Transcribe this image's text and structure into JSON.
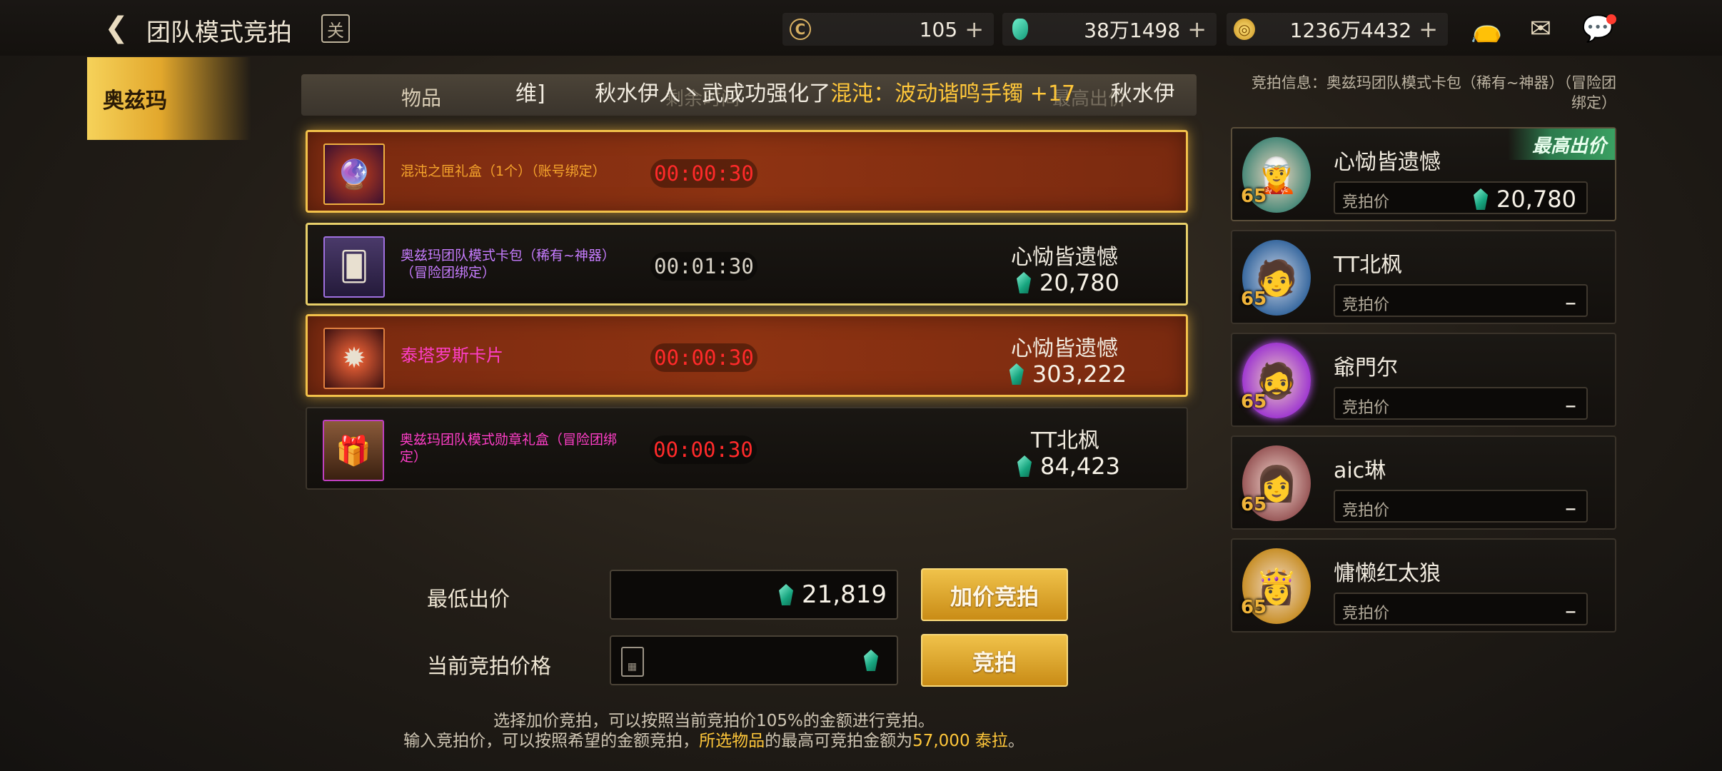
{
  "header": {
    "title": "团队模式竞拍",
    "calendar_glyph": "关",
    "currencies": [
      {
        "name": "c-currency",
        "value": "105"
      },
      {
        "name": "gem-currency",
        "value": "38万1498"
      },
      {
        "name": "gold-currency",
        "value": "1236万4432"
      }
    ],
    "plus": "+"
  },
  "sidebar": {
    "tab": "奥兹玛"
  },
  "list": {
    "col_item": "物品",
    "col_ghost_time": "剩余时间",
    "col_ghost_price": "最高出价",
    "ticker_prefix": "维]",
    "ticker_text": "秋水伊人丶武成功强化了",
    "ticker_highlight": "混沌：波动谐鸣手镯 +17",
    "ticker_suffix": "秋水伊"
  },
  "auction_rows": [
    {
      "name": "混沌之匣礼盒（1个）（账号绑定）",
      "timer": "00:00:30",
      "bidder": "",
      "bid": ""
    },
    {
      "name": "奥兹玛团队模式卡包（稀有~神器）（冒险团绑定）",
      "timer": "00:01:30",
      "bidder": "心恸皆遗憾",
      "bid": "20,780"
    },
    {
      "name": "泰塔罗斯卡片",
      "timer": "00:00:30",
      "bidder": "心恸皆遗憾",
      "bid": "303,222"
    },
    {
      "name": "奥兹玛团队模式勋章礼盒（冒险团绑定）",
      "timer": "00:00:30",
      "bidder": "TT北枫",
      "bid": "84,423"
    }
  ],
  "bid_panel": {
    "min_label": "最低出价",
    "min_value": "21,819",
    "raise_button": "加价竞拍",
    "current_label": "当前竞拍价格",
    "current_value": "",
    "bid_button": "竞拍",
    "hint1": "选择加价竞拍，可以按照当前竞拍价105%的金额进行竞拍。",
    "hint2_a": "输入竞拍价，可以按照希望的金额竞拍，",
    "hint2_b": "所选物品",
    "hint2_c": "的最高可竞拍金额为",
    "hint2_d": "57,000 泰拉",
    "hint2_e": "。"
  },
  "right_panel": {
    "info": "竞拍信息：奥兹玛团队模式卡包（稀有~神器）（冒险团绑定）",
    "top_badge": "最高出价",
    "price_label": "竞拍价",
    "bidders": [
      {
        "name": "心恸皆遗憾",
        "level": "65",
        "price": "20,780"
      },
      {
        "name": "TT北枫",
        "level": "65",
        "price": "–"
      },
      {
        "name": "爺門尔",
        "level": "65",
        "price": "–"
      },
      {
        "name": "aic琳",
        "level": "65",
        "price": "–"
      },
      {
        "name": "慵懒红太狼",
        "level": "65",
        "price": "–"
      }
    ]
  },
  "colors": {
    "accent_gold": "#f0c24a",
    "timer_red": "#ff2a2a",
    "gem_green": "#17a57f",
    "highlight_yellow": "#ffc73a"
  }
}
